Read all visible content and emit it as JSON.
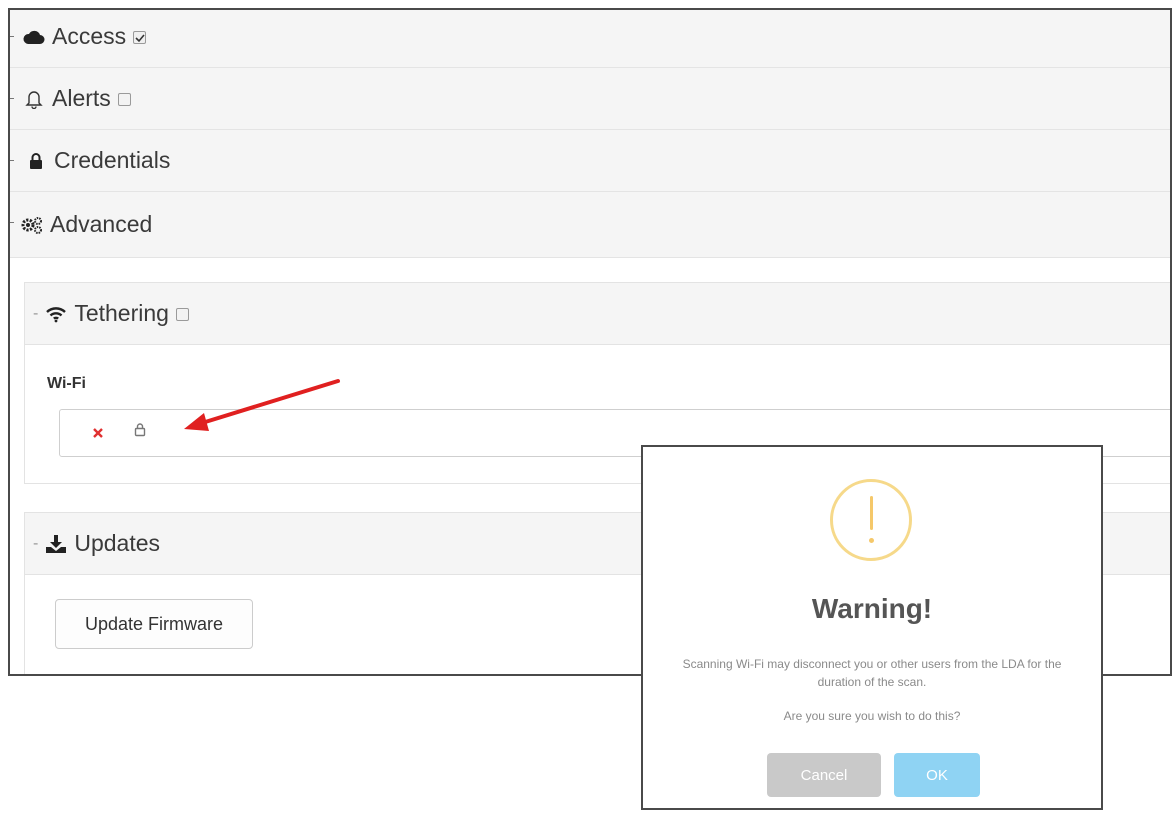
{
  "sections": {
    "access": {
      "label": "Access",
      "icon": "cloud-icon",
      "checked": true
    },
    "alerts": {
      "label": "Alerts",
      "icon": "bell-icon",
      "checked": false
    },
    "credentials": {
      "label": "Credentials",
      "icon": "lock-icon"
    },
    "advanced": {
      "label": "Advanced",
      "icon": "gears-icon"
    }
  },
  "tethering": {
    "label": "Tethering",
    "icon": "wifi-icon",
    "checked": false,
    "wifi_label": "Wi-Fi",
    "wifi_status_icon": "x-icon",
    "wifi_lock_icon": "lock-icon"
  },
  "updates": {
    "label": "Updates",
    "icon": "download-icon",
    "button_label": "Update Firmware"
  },
  "dialog": {
    "title": "Warning!",
    "message": "Scanning Wi-Fi may disconnect you or other users from the LDA for the duration of the scan.",
    "question": "Are you sure you wish to do this?",
    "cancel_label": "Cancel",
    "ok_label": "OK"
  },
  "colors": {
    "warning": "#f5c86a",
    "ok_button": "#8fd3f3",
    "cancel_button": "#c9c9c9",
    "annotation_arrow": "#e02020",
    "wifi_x": "#e03030"
  }
}
